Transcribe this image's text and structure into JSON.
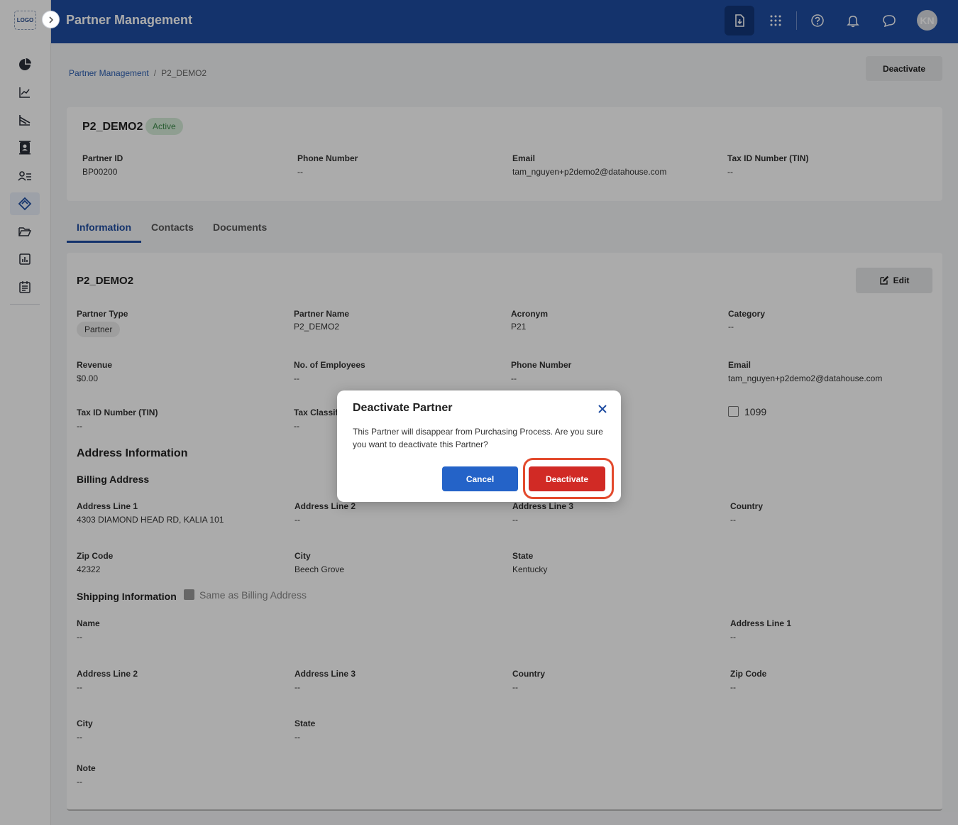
{
  "sidebar": {
    "logo_text": "LOGO",
    "items": [
      {
        "icon": "pie-chart-icon"
      },
      {
        "icon": "line-chart-icon"
      },
      {
        "icon": "area-chart-icon"
      },
      {
        "icon": "contacts-book-icon"
      },
      {
        "icon": "user-list-icon"
      },
      {
        "icon": "partner-tag-icon",
        "active": true
      },
      {
        "icon": "folder-open-icon"
      },
      {
        "icon": "report-icon"
      },
      {
        "icon": "calendar-icon"
      }
    ]
  },
  "header": {
    "title": "Partner Management",
    "icons": [
      "download-file-icon",
      "apps-grid-icon",
      "help-icon",
      "bell-icon",
      "chat-icon"
    ],
    "avatar_initials": "KN"
  },
  "breadcrumb": {
    "root": "Partner Management",
    "separator": "/",
    "current": "P2_DEMO2"
  },
  "top_actions": {
    "deactivate_label": "Deactivate"
  },
  "summary": {
    "name": "P2_DEMO2",
    "status": "Active",
    "fields": [
      {
        "label": "Partner ID",
        "value": "BP00200"
      },
      {
        "label": "Phone Number",
        "value": "--"
      },
      {
        "label": "Email",
        "value": "tam_nguyen+p2demo2@datahouse.com"
      },
      {
        "label": "Tax ID Number (TIN)",
        "value": "--"
      }
    ]
  },
  "tabs": [
    {
      "label": "Information",
      "active": true
    },
    {
      "label": "Contacts"
    },
    {
      "label": "Documents"
    }
  ],
  "detail": {
    "title": "P2_DEMO2",
    "edit_label": "Edit",
    "partner_type_label": "Partner Type",
    "partner_type_value": "Partner",
    "partner_name_label": "Partner Name",
    "partner_name_value": "P2_DEMO2",
    "acronym_label": "Acronym",
    "acronym_value": "P21",
    "category_label": "Category",
    "category_value": "--",
    "revenue_label": "Revenue",
    "revenue_value": "$0.00",
    "employees_label": "No. of Employees",
    "employees_value": "--",
    "phone_label": "Phone Number",
    "phone_value": "--",
    "email_label": "Email",
    "email_value": "tam_nguyen+p2demo2@datahouse.com",
    "tin_label": "Tax ID Number (TIN)",
    "tin_value": "--",
    "tax_class_label": "Tax Classif",
    "tax_class_value": "--",
    "form_1099_label": "1099",
    "address_section": "Address Information",
    "billing_section": "Billing Address",
    "billing": {
      "line1_label": "Address Line 1",
      "line1_value": "4303 DIAMOND HEAD RD, KALIA 101",
      "line2_label": "Address Line 2",
      "line2_value": "--",
      "line3_label": "Address Line 3",
      "line3_value": "--",
      "country_label": "Country",
      "country_value": "--",
      "zip_label": "Zip Code",
      "zip_value": "42322",
      "city_label": "City",
      "city_value": "Beech Grove",
      "state_label": "State",
      "state_value": "Kentucky"
    },
    "shipping_section": "Shipping Information",
    "same_as_billing_label": "Same as Billing Address",
    "shipping": {
      "name_label": "Name",
      "name_value": "--",
      "line1_label": "Address Line 1",
      "line1_value": "--",
      "line2_label": "Address Line 2",
      "line2_value": "--",
      "line3_label": "Address Line 3",
      "line3_value": "--",
      "country_label": "Country",
      "country_value": "--",
      "zip_label": "Zip Code",
      "zip_value": "--",
      "city_label": "City",
      "city_value": "--",
      "state_label": "State",
      "state_value": "--"
    },
    "note_label": "Note",
    "note_value": "--"
  },
  "modal": {
    "title": "Deactivate Partner",
    "message": "This Partner will disappear from Purchasing Process. Are you sure you want to deactivate this Partner?",
    "cancel_label": "Cancel",
    "confirm_label": "Deactivate"
  },
  "colors": {
    "header_bg": "#1f4da1",
    "cancel_button": "#2463c8",
    "deactivate_button": "#d12a25",
    "highlight_ring": "#e34a2d",
    "status_badge_bg": "#d6ecd9"
  }
}
